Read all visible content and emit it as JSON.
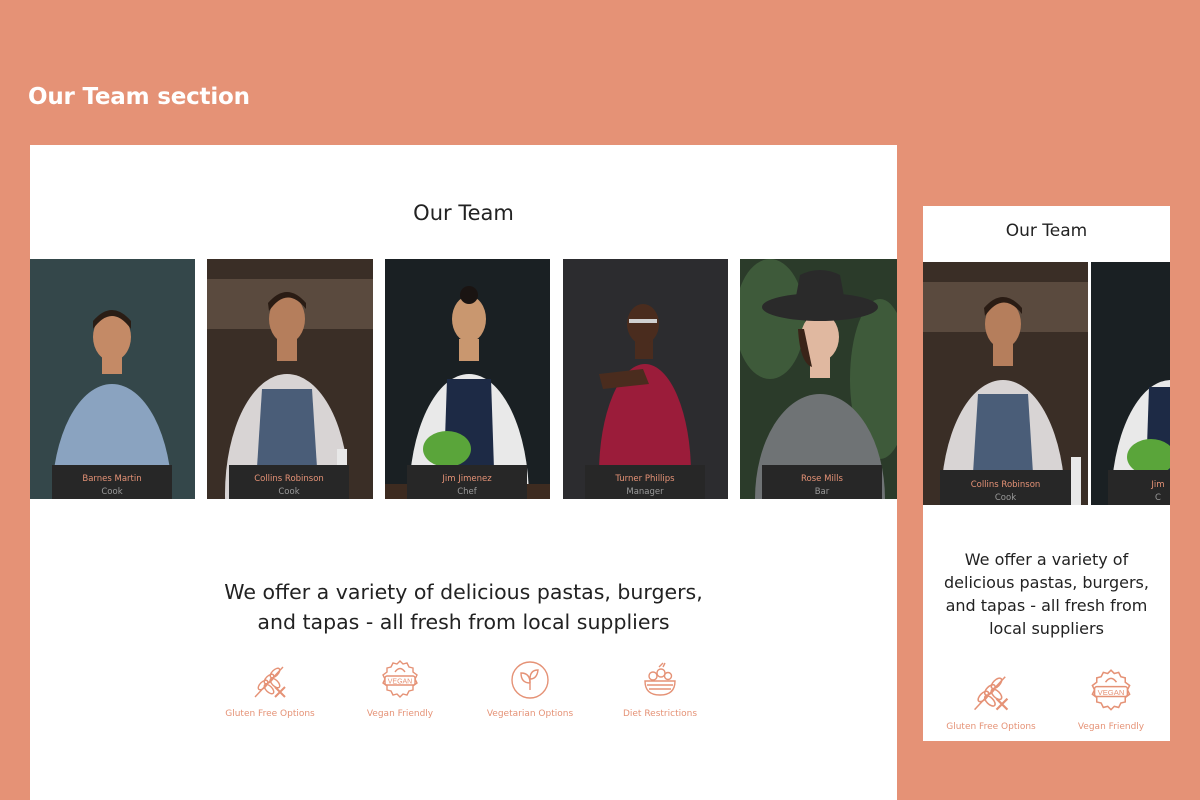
{
  "section_label": "Our Team section",
  "desktop": {
    "heading": "Our Team",
    "team": [
      {
        "name": "Barnes Martin",
        "role": "Cook",
        "bg": "#2c3a3c",
        "skin": "#c48a66",
        "shirt": "#8aa3c0",
        "icon": "person-photo-icon"
      },
      {
        "name": "Collins Robinson",
        "role": "Cook",
        "bg": "#3a2e26",
        "skin": "#b57e5c",
        "shirt": "#d8d4d4",
        "icon": "person-photo-icon"
      },
      {
        "name": "Jim Jimenez",
        "role": "Chef",
        "bg": "#1a2023",
        "skin": "#c9976f",
        "shirt": "#e9e9e9",
        "icon": "person-photo-icon"
      },
      {
        "name": "Turner Phillips",
        "role": "Manager",
        "bg": "#2c2c2f",
        "skin": "#4a2c1e",
        "shirt": "#9b1c3a",
        "icon": "person-photo-icon"
      },
      {
        "name": "Rose Mills",
        "role": "Bar",
        "bg": "#2b3b2a",
        "skin": "#e0b8a0",
        "shirt": "#6f7375",
        "icon": "person-photo-icon"
      }
    ],
    "tagline_line1": "We offer a variety of delicious pastas, burgers,",
    "tagline_line2": "and tapas - all fresh from local suppliers",
    "features": [
      {
        "label": "Gluten Free Options",
        "icon": "gluten-free-icon"
      },
      {
        "label": "Vegan Friendly",
        "icon": "vegan-badge-icon"
      },
      {
        "label": "Vegetarian Options",
        "icon": "leaf-icon"
      },
      {
        "label": "Diet Restrictions",
        "icon": "salad-bowl-icon"
      }
    ]
  },
  "mobile": {
    "heading": "Our Team",
    "team": [
      {
        "name": "Collins Robinson",
        "role": "Cook"
      },
      {
        "name": "Jim",
        "role": "C"
      }
    ],
    "tagline_line1": "We offer a variety of",
    "tagline_line2": "delicious pastas, burgers,",
    "tagline_line3": "and tapas - all fresh from",
    "tagline_line4": "local suppliers",
    "features": [
      {
        "label": "Gluten Free Options"
      },
      {
        "label": "Vegan Friendly"
      }
    ]
  },
  "colors": {
    "background": "#E59276",
    "accent": "#E59276",
    "card_label_bg": "#272727",
    "text_dark": "#222222"
  }
}
